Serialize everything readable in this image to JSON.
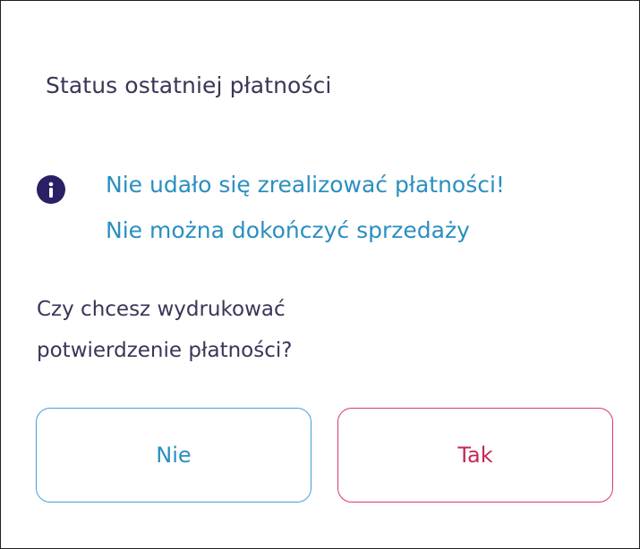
{
  "dialog": {
    "title": "Status ostatniej płatności",
    "alert": {
      "icon": "info-icon",
      "line1": "Nie udało się zrealizować płatności!",
      "line2": "Nie można dokończyć sprzedaży"
    },
    "question": {
      "line1": "Czy chcesz wydrukować",
      "line2": "potwierdzenie płatności?"
    },
    "buttons": {
      "no_label": "Nie",
      "yes_label": "Tak"
    }
  },
  "colors": {
    "title_text": "#3b3557",
    "alert_text": "#2a8fc0",
    "info_icon_bg": "#2a2066",
    "no_button_border": "#3fa3d6",
    "yes_button_border": "#d83a62",
    "yes_button_text": "#c22a55"
  }
}
